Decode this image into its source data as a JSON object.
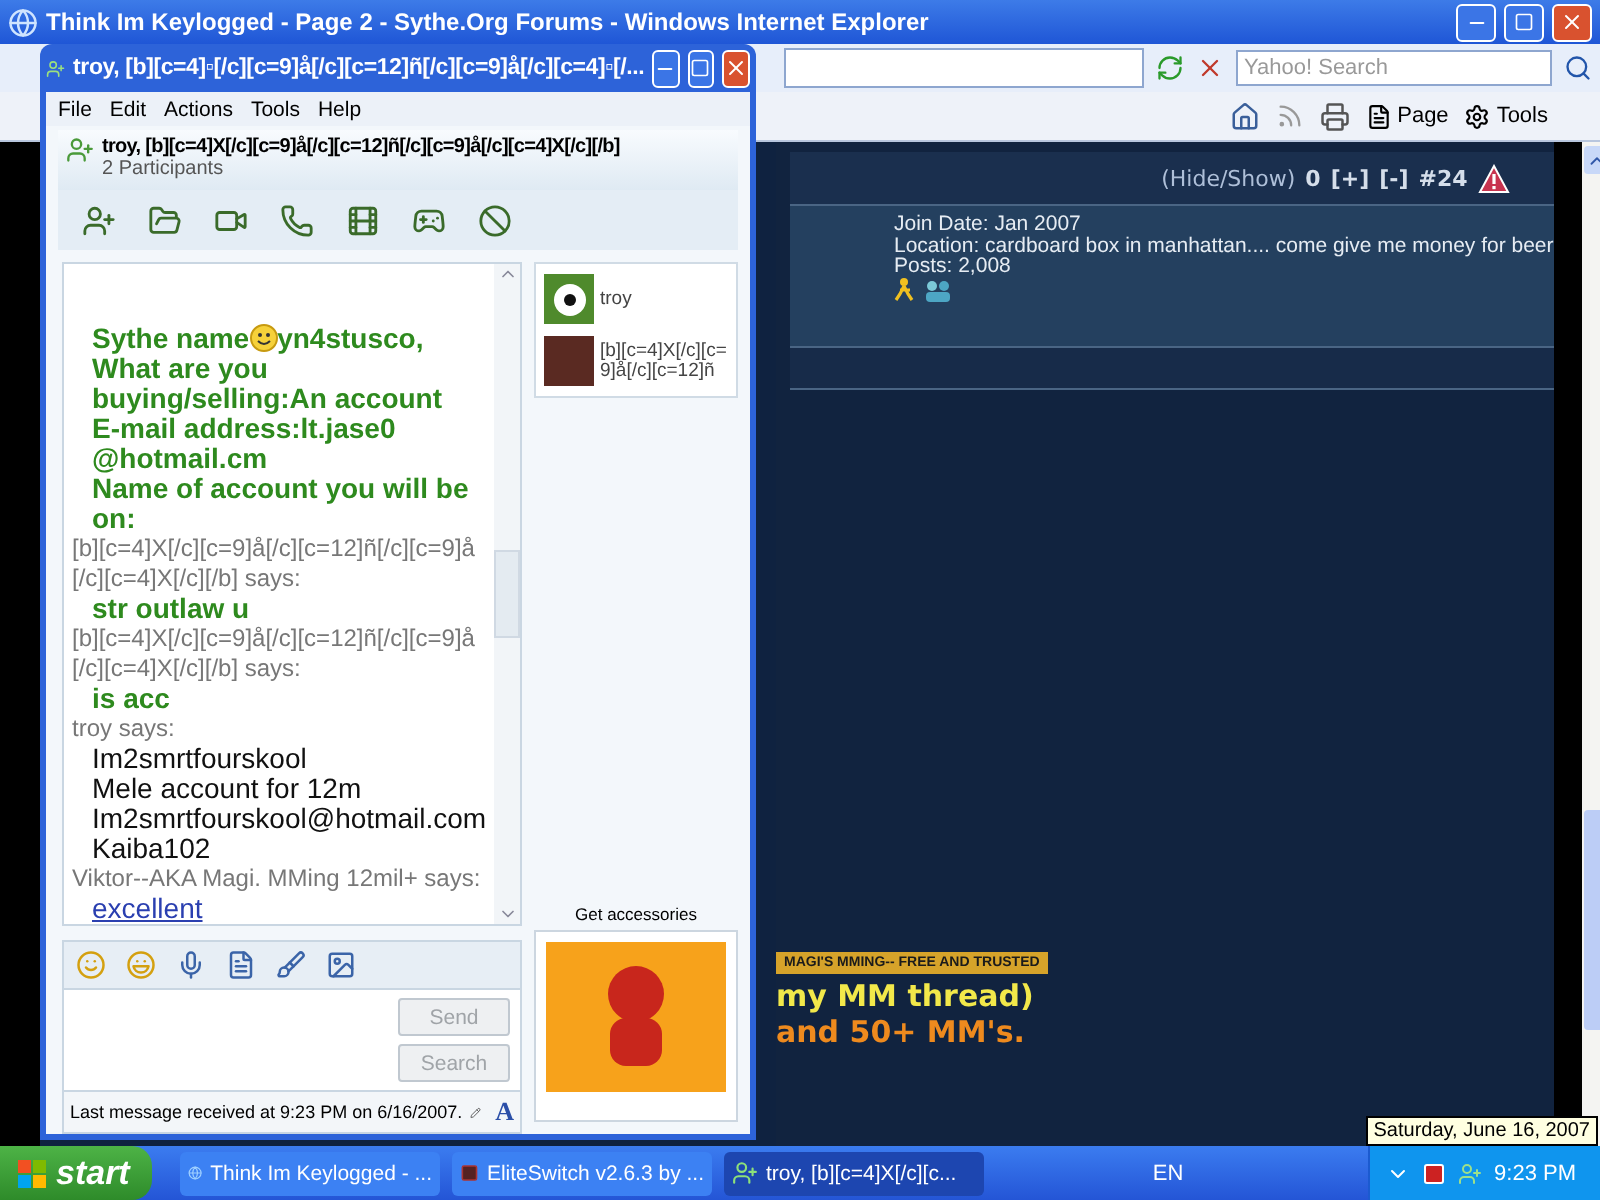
{
  "ie": {
    "title": "Think Im Keylogged - Page 2 - Sythe.Org Forums - Windows Internet Explorer",
    "search": {
      "placeholder": "Yahoo! Search"
    },
    "commands": [
      "Page",
      "Tools"
    ]
  },
  "post": {
    "hide_show": "(Hide/Show)",
    "count": "0",
    "plus": "[+]",
    "minus": "[-]",
    "number": "#24",
    "info": [
      "Join Date: Jan 2007",
      "Location: cardboard box in manhattan.... come give me money for beer",
      "Posts: 2,008"
    ],
    "banner": "MAGI'S MMING-- FREE AND TRUSTED",
    "lines": [
      {
        "text": "my MM thread)",
        "color": "#f2e84a"
      },
      {
        "text": "and 50+ MM's.",
        "color": "#ee8a1e"
      }
    ]
  },
  "chat": {
    "title": "troy, [b][c=4]▫[/c][c=9]å[/c][c=12]ñ[/c][c=9]å[/c][c=4]▫[/...",
    "menu": [
      "File",
      "Edit",
      "Actions",
      "Tools",
      "Help"
    ],
    "header": {
      "name": "troy, [b][c=4]X[/c][c=9]å[/c][c=12]ñ[/c][c=9]å[/c][c=4]X[/c][/b]",
      "participants": "2 Participants"
    },
    "messages": [
      {
        "kind": "green",
        "lines": [
          {
            "text": "Sythe name",
            "after": "yn4stusco,"
          },
          {
            "text": "What are you"
          },
          {
            "text": "buying/selling:An account"
          },
          {
            "text": "E-mail address:lt.jase0"
          },
          {
            "text": "@hotmail.cm"
          },
          {
            "text": "Name of account you will be"
          },
          {
            "text": "on:"
          }
        ]
      },
      {
        "sender": "[b][c=4]X[/c][c=9]å[/c][c=12]ñ[/c][c=9]å [/c][c=4]X[/c][/b] says:",
        "kind": "green",
        "lines": [
          {
            "text": "str outlaw u"
          }
        ]
      },
      {
        "sender": "[b][c=4]X[/c][c=9]å[/c][c=12]ñ[/c][c=9]å [/c][c=4]X[/c][/b] says:",
        "kind": "green",
        "lines": [
          {
            "text": "is acc"
          }
        ]
      },
      {
        "sender": "troy says:",
        "kind": "plain",
        "lines": [
          {
            "text": "Im2smrtfourskool"
          },
          {
            "text": "Mele account for 12m"
          },
          {
            "text": "Im2smrtfourskool@hotmail.com"
          },
          {
            "text": "Kaiba102"
          }
        ]
      },
      {
        "sender": "Viktor--AKA Magi. MMing 12mil+ says:",
        "kind": "link",
        "lines": [
          {
            "text": "excellent"
          }
        ]
      }
    ],
    "contacts": [
      {
        "name": "troy",
        "kind": "ball"
      },
      {
        "name": "[b][c=4]X[/c][c= 9]å[/c][c=12]ñ",
        "kind": "photo"
      }
    ],
    "accessories": "Get accessories",
    "buttons": [
      {
        "label": "Send",
        "disabled": true
      },
      {
        "label": "Search",
        "disabled": true
      }
    ],
    "status": "Last message received at 9:23 PM on 6/16/2007.",
    "font_button": "A"
  },
  "taskbar": {
    "start": "start",
    "tasks": [
      {
        "label": "Think Im Keylogged - ...",
        "kind": "browser",
        "selected": false
      },
      {
        "label": "EliteSwitch v2.6.3 by ...",
        "kind": "app",
        "selected": false
      },
      {
        "label": "troy, [b][c=4]X[/c][c...",
        "kind": "chat",
        "selected": true
      }
    ],
    "language": "EN",
    "clock": "9:23 PM",
    "tooltip": "Saturday, June 16, 2007"
  }
}
